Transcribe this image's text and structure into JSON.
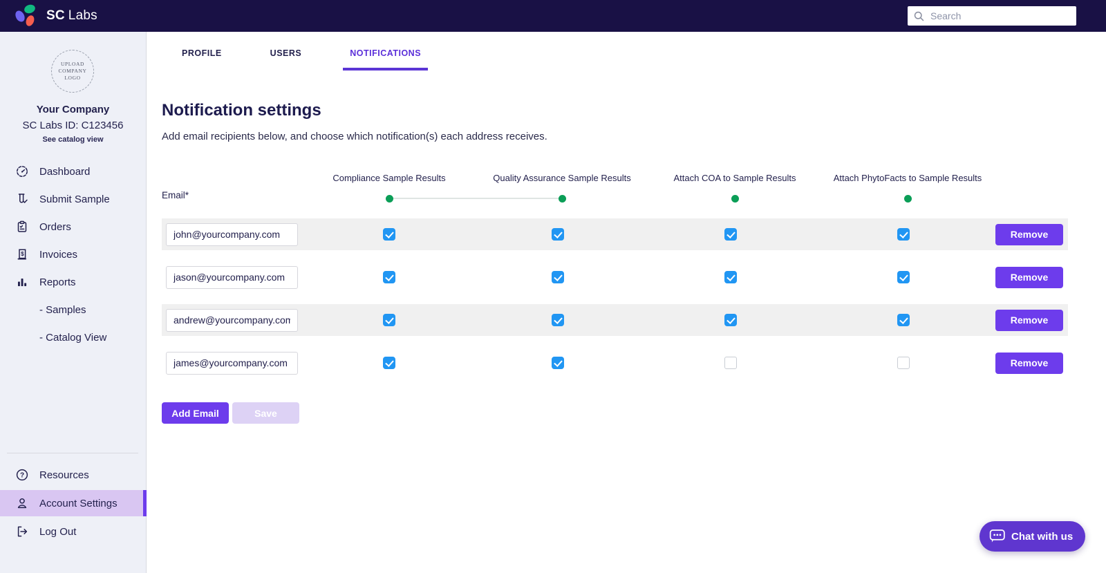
{
  "topbar": {
    "brand_bold": "SC",
    "brand_light": "Labs",
    "search_placeholder": "Search"
  },
  "sidebar": {
    "upload_logo_lines": [
      "UPLOAD",
      "COMPANY",
      "LOGO"
    ],
    "company_name": "Your Company",
    "company_id": "SC Labs ID: C123456",
    "catalog_link": "See catalog view",
    "nav": [
      {
        "label": "Dashboard",
        "icon": "dashboard-gauge-icon"
      },
      {
        "label": "Submit Sample",
        "icon": "test-tube-icon"
      },
      {
        "label": "Orders",
        "icon": "clipboard-icon"
      },
      {
        "label": "Invoices",
        "icon": "invoice-icon"
      },
      {
        "label": "Reports",
        "icon": "bar-chart-icon"
      },
      {
        "label": "- Samples",
        "icon": null
      },
      {
        "label": "- Catalog View",
        "icon": null
      }
    ],
    "bottom_nav": [
      {
        "label": "Resources",
        "icon": "question-circle-icon",
        "active": false
      },
      {
        "label": "Account Settings",
        "icon": "person-icon",
        "active": true
      },
      {
        "label": "Log Out",
        "icon": "logout-icon",
        "active": false
      }
    ]
  },
  "tabs": [
    {
      "label": "PROFILE",
      "active": false
    },
    {
      "label": "USERS",
      "active": false
    },
    {
      "label": "NOTIFICATIONS",
      "active": true
    }
  ],
  "main": {
    "title": "Notification settings",
    "subtitle": "Add email recipients below, and choose which notification(s) each address receives.",
    "email_label": "Email*",
    "columns": [
      "Compliance Sample Results",
      "Quality Assurance Sample Results",
      "Attach COA to Sample Results",
      "Attach PhytoFacts to Sample Results"
    ],
    "rows": [
      {
        "email": "john@yourcompany.com",
        "checks": [
          true,
          true,
          true,
          true
        ]
      },
      {
        "email": "jason@yourcompany.com",
        "checks": [
          true,
          true,
          true,
          true
        ]
      },
      {
        "email": "andrew@yourcompany.com",
        "checks": [
          true,
          true,
          true,
          true
        ]
      },
      {
        "email": "james@yourcompany.com",
        "checks": [
          true,
          true,
          false,
          false
        ]
      }
    ],
    "remove_label": "Remove",
    "add_email_label": "Add Email",
    "save_label": "Save"
  },
  "chat": {
    "label": "Chat with us"
  },
  "colors": {
    "topbar_navy": "#191145",
    "accent_purple": "#6d3cec",
    "tab_purple": "#5b2fd9",
    "checkbox_blue": "#2196f3",
    "dot_green": "#0b9e57",
    "chat_purple": "#5f36cf",
    "save_disabled": "#ddd2f5",
    "sidebar_active_bg": "#d9c6f2"
  }
}
